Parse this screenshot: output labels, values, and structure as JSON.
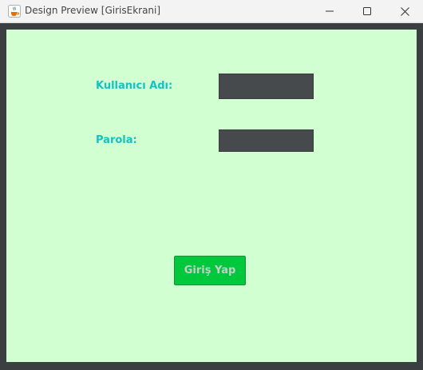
{
  "window": {
    "title": "Design Preview [GirisEkrani]",
    "icon": "java-cup-icon",
    "controls": [
      "minimize-icon",
      "maximize-icon",
      "close-icon"
    ]
  },
  "form": {
    "username_label": "Kullanıcı Adı:",
    "username_value": "",
    "password_label": "Parola:",
    "password_value": "",
    "login_button": "Giriş Yap"
  },
  "colors": {
    "background": "#d2ffd2",
    "label": "#13c2c2",
    "field": "#474a4c",
    "button": "#00c83c"
  }
}
